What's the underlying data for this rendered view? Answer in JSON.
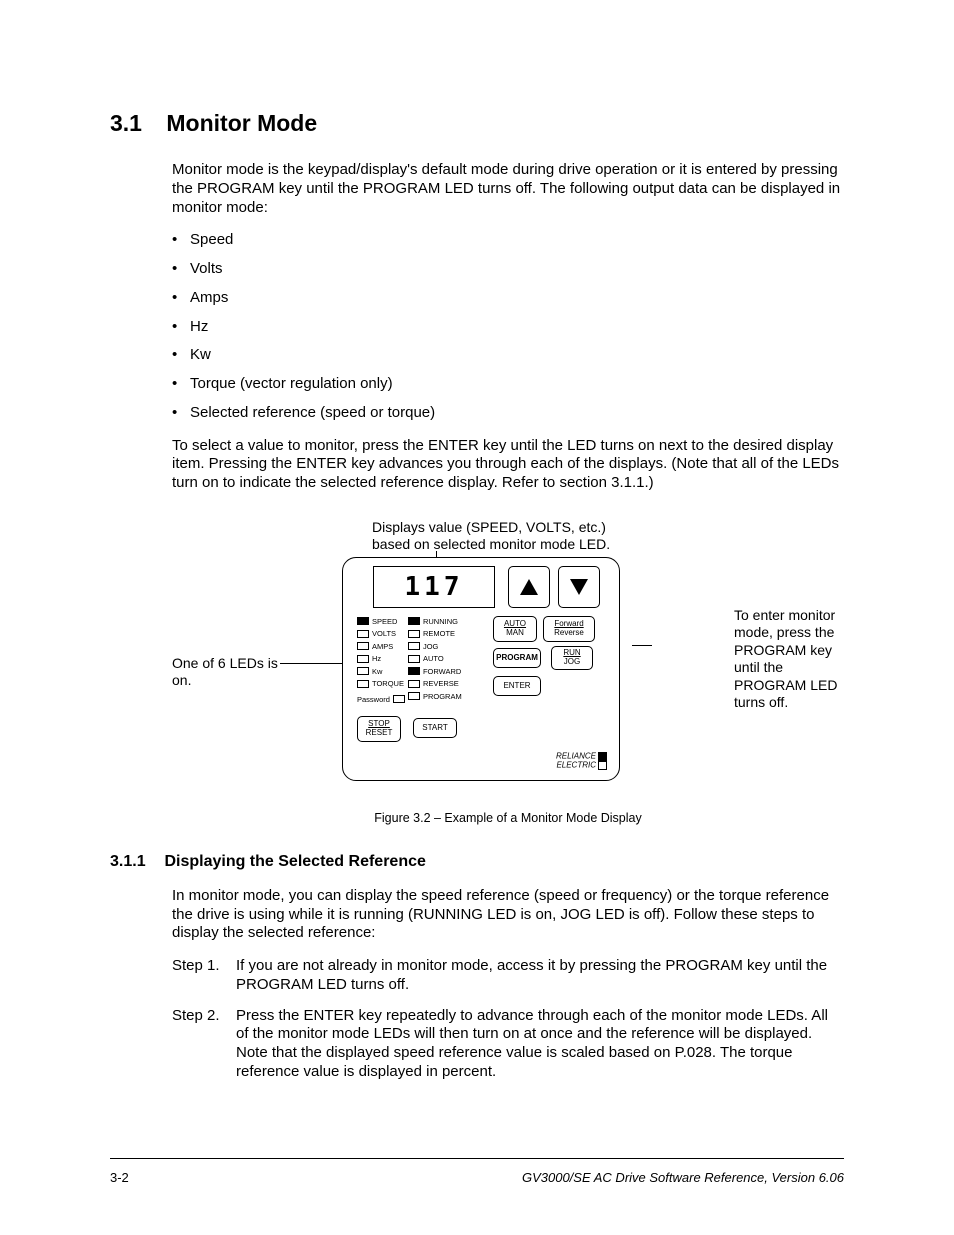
{
  "heading1_num": "3.1",
  "heading1_text": "Monitor Mode",
  "intro": "Monitor mode is the keypad/display's default mode during drive operation or it is entered by pressing the PROGRAM key until the PROGRAM LED turns off. The following output data can be displayed in monitor mode:",
  "bullets": [
    "Speed",
    "Volts",
    "Amps",
    "Hz",
    "Kw",
    "Torque (vector regulation only)",
    "Selected reference (speed or torque)"
  ],
  "para2": "To select a value to monitor, press the ENTER key until the LED turns on next to the desired display item. Pressing the ENTER key advances you through each of the displays. (Note that all of the LEDs turn on to indicate the selected reference display. Refer to section 3.1.1.)",
  "fig_top_note_l1": "Displays value (SPEED, VOLTS, etc.)",
  "fig_top_note_l2": "based on selected monitor mode LED.",
  "fig_left_note": "One of 6 LEDs is on.",
  "fig_right_note": "To enter monitor mode, press the PROGRAM key until the PROGRAM LED turns off.",
  "display_value": "117",
  "led_col1": [
    {
      "label": "SPEED",
      "on": true
    },
    {
      "label": "VOLTS",
      "on": false
    },
    {
      "label": "AMPS",
      "on": false
    },
    {
      "label": "Hz",
      "on": false
    },
    {
      "label": "Kw",
      "on": false
    },
    {
      "label": "TORQUE",
      "on": false
    }
  ],
  "led_col2": [
    {
      "label": "RUNNING",
      "on": true
    },
    {
      "label": "REMOTE",
      "on": false
    },
    {
      "label": "JOG",
      "on": false
    },
    {
      "label": "AUTO",
      "on": false
    },
    {
      "label": "FORWARD",
      "on": true
    },
    {
      "label": "REVERSE",
      "on": false
    },
    {
      "label": "PROGRAM",
      "on": false
    }
  ],
  "password_label": "Password",
  "btn_auto_top": "AUTO",
  "btn_auto_bot": "MAN",
  "btn_fwd_top": "Forward",
  "btn_fwd_bot": "Reverse",
  "btn_program": "PROGRAM",
  "btn_run_top": "RUN",
  "btn_run_bot": "JOG",
  "btn_enter": "ENTER",
  "btn_stop_top": "STOP",
  "btn_stop_bot": "RESET",
  "btn_start": "START",
  "brand_top": "RELIANCE",
  "brand_bot": "ELECTRIC",
  "caption": "Figure 3.2 – Example of a Monitor Mode Display",
  "heading2_num": "3.1.1",
  "heading2_text": "Displaying the Selected Reference",
  "sub_intro": "In monitor mode, you can display the speed reference (speed or frequency) or the torque reference the drive is using while it is running (RUNNING LED is on, JOG LED is off). Follow these steps to display the selected reference:",
  "step1_label": "Step 1.",
  "step1_text": "If you are not already in monitor mode, access it by pressing the PROGRAM key until the PROGRAM LED turns off.",
  "step2_label": "Step 2.",
  "step2_text": "Press the ENTER key repeatedly to advance through each of the monitor mode LEDs. All of the monitor mode LEDs will then turn on at once and the reference will be displayed. Note that the displayed speed reference value is scaled based on P.028. The torque reference value is displayed in percent.",
  "footer_left": "3-2",
  "footer_right": "GV3000/SE AC Drive Software Reference, Version 6.06"
}
